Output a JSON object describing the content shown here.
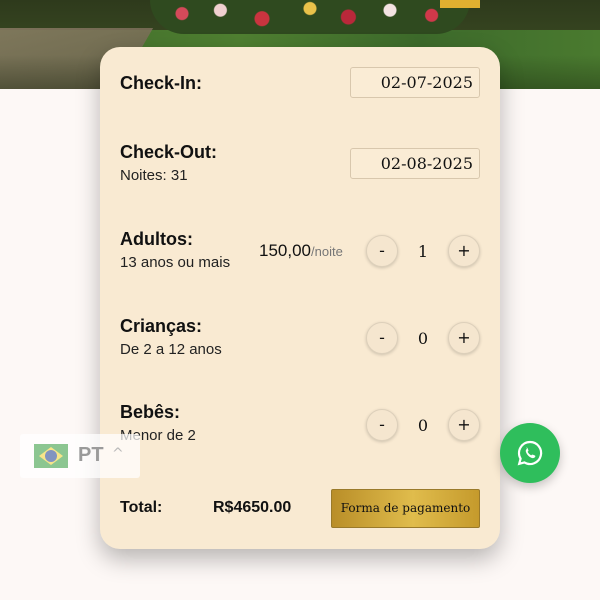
{
  "checkin": {
    "label": "Check-In:",
    "date": "02-07-2025"
  },
  "checkout": {
    "label": "Check-Out:",
    "sub": "Noites: 31",
    "date": "02-08-2025"
  },
  "adults": {
    "label": "Adultos:",
    "sub": "13 anos ou mais",
    "price": "150,00",
    "price_unit": "/noite",
    "minus": "-",
    "plus": "+",
    "count": "1"
  },
  "children": {
    "label": "Crianças:",
    "sub": "De 2 a 12 anos",
    "minus": "-",
    "plus": "+",
    "count": "0"
  },
  "babies": {
    "label": "Bebês:",
    "sub": "Menor de 2",
    "minus": "-",
    "plus": "+",
    "count": "0"
  },
  "footer": {
    "total_label": "Total:",
    "total_value": "R$4650.00",
    "pay_button": "Forma de pagamento"
  },
  "language": {
    "code": "PT",
    "chevron": "^",
    "flag_icon": "brazil-flag-icon"
  },
  "whatsapp": {
    "icon": "whatsapp-icon",
    "color": "#2fbe5c"
  },
  "colors": {
    "card_bg": "#f9ead2",
    "button_gold": "#d4ab3c"
  }
}
